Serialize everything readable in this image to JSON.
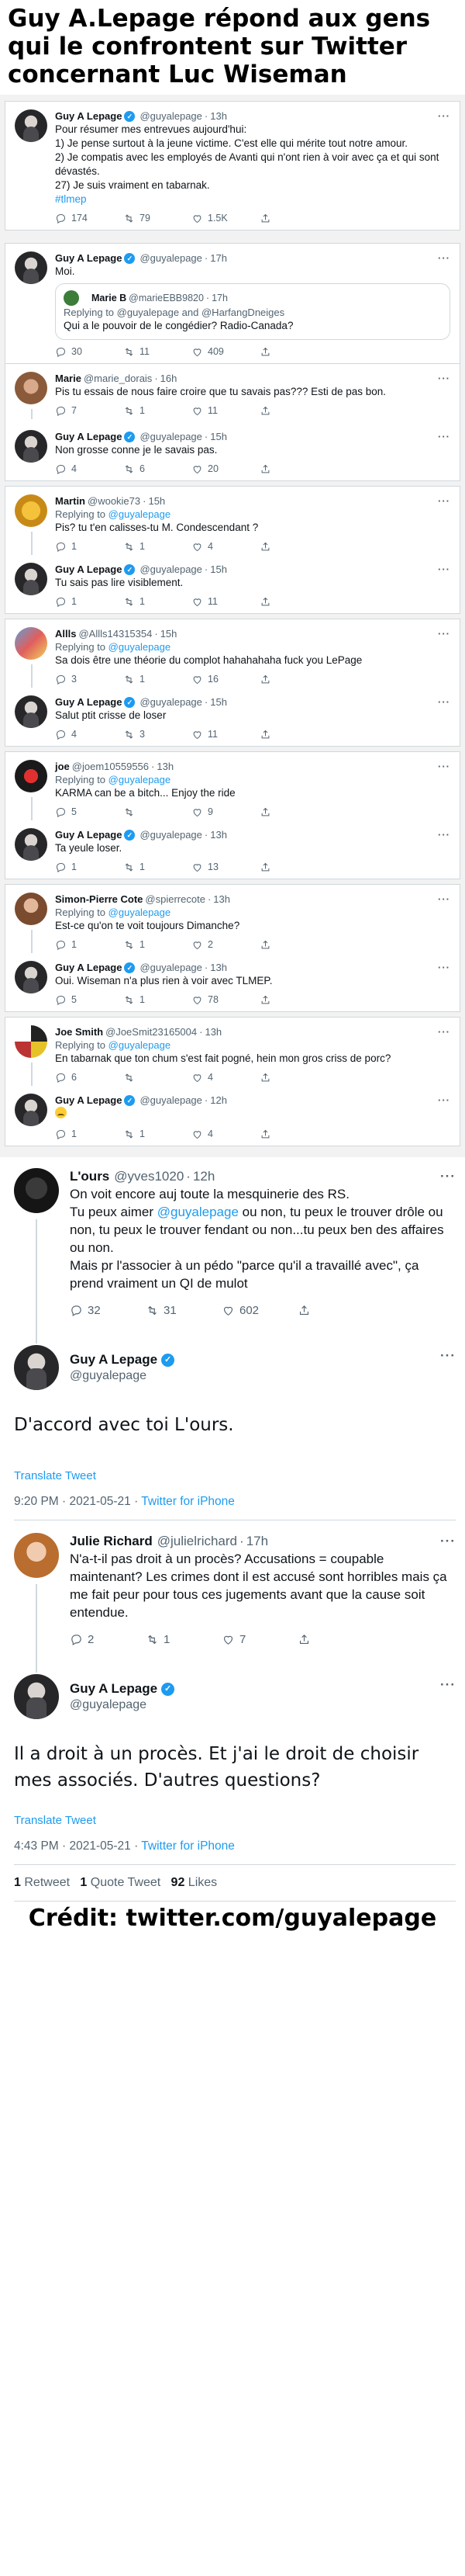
{
  "headline": "Guy A.Lepage répond aux gens qui le confrontent sur Twitter concernant Luc Wiseman",
  "top_tweet": {
    "name": "Guy A Lepage",
    "handle": "@guyalepage",
    "time": "13h",
    "lines": [
      "Pour résumer mes entrevues aujourd'hui:",
      "1) Je pense surtout à la jeune victime. C'est elle qui mérite tout notre amour.",
      "2) Je compatis avec les employés de Avanti qui n'ont rien à voir avec ça et qui sont dévastés.",
      "27) Je suis vraiment en tabarnak."
    ],
    "hashtag": "#tlmep",
    "replies": "174",
    "retweets": "79",
    "likes": "1.5K"
  },
  "thread": [
    {
      "name": "Guy A Lepage",
      "handle": "@guyalepage",
      "time": "17h",
      "text": "Moi.",
      "quote": {
        "name": "Marie B",
        "handle": "@marieEBB9820",
        "time": "17h",
        "replying": "Replying to @guyalepage and @HarfangDneiges",
        "text": "Qui a le pouvoir de le congédier? Radio-Canada?"
      },
      "replies": "30",
      "retweets": "11",
      "likes": "409"
    },
    {
      "name": "Marie",
      "handle": "@marie_dorais",
      "time": "16h",
      "text": "Pis tu essais de nous faire croire que tu savais pas??? Esti de pas bon.",
      "replies": "7",
      "retweets": "1",
      "likes": "11"
    },
    {
      "name": "Guy A Lepage",
      "handle": "@guyalepage",
      "time": "15h",
      "text": "Non grosse conne je le savais pas.",
      "replies": "4",
      "retweets": "6",
      "likes": "20"
    }
  ],
  "pairs": [
    {
      "q": {
        "name": "Martin",
        "handle": "@wookie73",
        "time": "15h",
        "replying": "@guyalepage",
        "text": "Pis? tu t'en calisses-tu M. Condescendant ?",
        "replies": "1",
        "retweets": "1",
        "likes": "4"
      },
      "a": {
        "name": "Guy A Lepage",
        "handle": "@guyalepage",
        "time": "15h",
        "text": "Tu sais pas lire visiblement.",
        "replies": "1",
        "retweets": "1",
        "likes": "11"
      }
    },
    {
      "q": {
        "name": "Allls",
        "handle": "@Allls14315354",
        "time": "15h",
        "replying": "@guyalepage",
        "text": "Sa dois être une théorie du complot hahahahaha fuck you LePage",
        "replies": "3",
        "retweets": "1",
        "likes": "16"
      },
      "a": {
        "name": "Guy A Lepage",
        "handle": "@guyalepage",
        "time": "15h",
        "text": "Salut ptit crisse de loser",
        "replies": "4",
        "retweets": "3",
        "likes": "11"
      }
    },
    {
      "q": {
        "name": "joe",
        "handle": "@joem10559556",
        "time": "13h",
        "replying": "@guyalepage",
        "text": "KARMA can be a bitch... Enjoy the ride",
        "replies": "5",
        "retweets": "",
        "likes": "9"
      },
      "a": {
        "name": "Guy A Lepage",
        "handle": "@guyalepage",
        "time": "13h",
        "text": "Ta yeule loser.",
        "replies": "1",
        "retweets": "1",
        "likes": "13"
      }
    },
    {
      "q": {
        "name": "Simon-Pierre Cote",
        "handle": "@spierrecote",
        "time": "13h",
        "replying": "@guyalepage",
        "text": "Est-ce qu'on te voit toujours Dimanche?",
        "replies": "1",
        "retweets": "1",
        "likes": "2"
      },
      "a": {
        "name": "Guy A Lepage",
        "handle": "@guyalepage",
        "time": "13h",
        "text": "Oui. Wiseman n'a plus rien à voir avec TLMEP.",
        "replies": "5",
        "retweets": "1",
        "likes": "78"
      }
    },
    {
      "q": {
        "name": "Joe Smith",
        "handle": "@JoeSmit23165004",
        "time": "13h",
        "replying": "@guyalepage",
        "text": "En tabarnak que ton chum s'est fait pogné, hein mon gros criss de porc?",
        "replies": "6",
        "retweets": "",
        "likes": "4"
      },
      "a": {
        "name": "Guy A Lepage",
        "handle": "@guyalepage",
        "time": "12h",
        "text": "",
        "replies": "1",
        "retweets": "1",
        "likes": "4"
      }
    }
  ],
  "big1": {
    "ours": {
      "name": "L'ours",
      "handle": "@yves1020",
      "time": "12h",
      "text_before": "On voit encore auj toute la mesquinerie des RS.\nTu peux aimer ",
      "mention": "@guyalepage",
      "text_after": " ou non, tu peux le trouver drôle ou non, tu peux le trouver fendant ou non...tu peux ben des affaires ou non.\nMais pr l'associer à un pédo \"parce qu'il a travaillé avec\", ça prend vraiment un QI de mulot",
      "replies": "32",
      "retweets": "31",
      "likes": "602"
    },
    "guy": {
      "name": "Guy A Lepage",
      "handle": "@guyalepage",
      "text": "D'accord avec toi L'ours.",
      "translate": "Translate Tweet",
      "time": "9:20 PM · 2021-05-21 · ",
      "source": "Twitter for iPhone"
    }
  },
  "big2": {
    "julie": {
      "name": "Julie Richard",
      "handle": "@julielrichard",
      "time": "17h",
      "text": "N'a-t-il pas droit à un procès? Accusations = coupable maintenant? Les crimes dont il est accusé sont horribles mais ça me fait peur pour tous ces jugements avant que la cause soit entendue.",
      "replies": "2",
      "retweets": "1",
      "likes": "7"
    },
    "guy": {
      "name": "Guy A Lepage",
      "handle": "@guyalepage",
      "text": "Il a droit à un procès. Et j'ai le droit de choisir mes associés. D'autres questions?",
      "translate": "Translate Tweet",
      "time": "4:43 PM · 2021-05-21 · ",
      "source": "Twitter for iPhone"
    },
    "stats": {
      "retweets_n": "1",
      "retweets_l": "Retweet",
      "quotes_n": "1",
      "quotes_l": "Quote Tweet",
      "likes_n": "92",
      "likes_l": "Likes"
    }
  },
  "credit": "Crédit: twitter.com/guyalepage",
  "accent": "#1d9bf0"
}
